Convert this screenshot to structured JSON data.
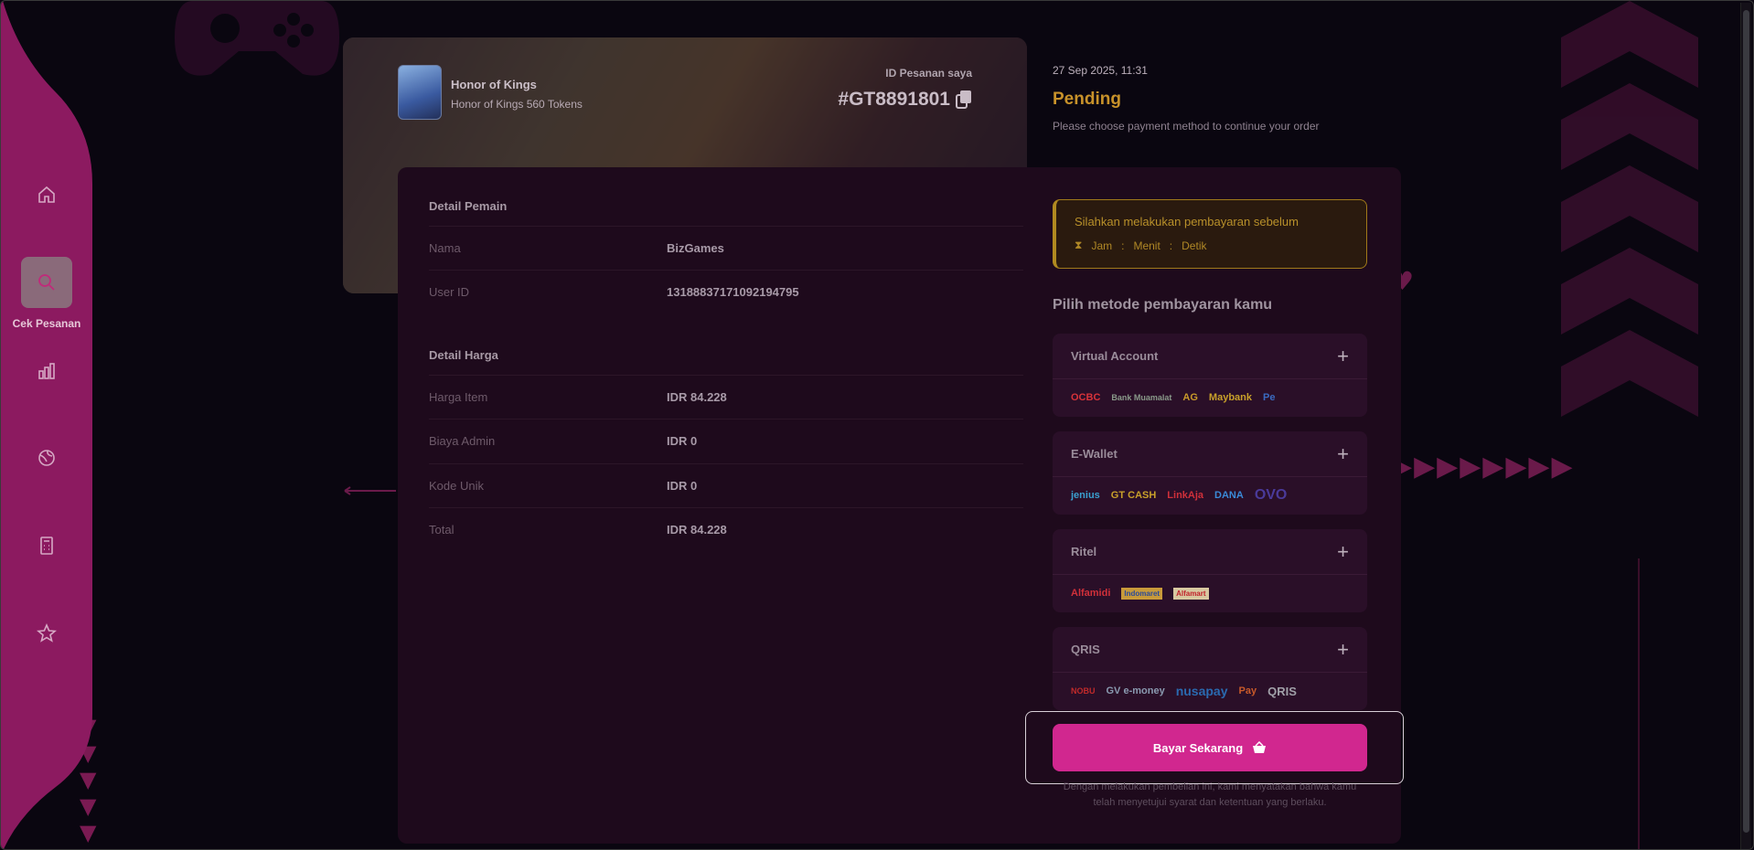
{
  "sidebar": {
    "items": [
      {
        "icon": "home-icon",
        "label": ""
      },
      {
        "icon": "search-icon",
        "label": "Cek Pesanan",
        "active": true
      },
      {
        "icon": "bar-chart-icon",
        "label": ""
      },
      {
        "icon": "globe-icon",
        "label": ""
      },
      {
        "icon": "calculator-icon",
        "label": ""
      },
      {
        "icon": "star-icon",
        "label": ""
      }
    ],
    "active_label": "Cek Pesanan"
  },
  "banner": {
    "game": "Honor of Kings",
    "product": "Honor of Kings 560 Tokens",
    "order_label": "ID Pesanan saya",
    "order_id": "#GT8891801"
  },
  "order_status": {
    "date": "27 Sep 2025, 11:31",
    "status": "Pending",
    "message": "Please choose payment method to continue your order"
  },
  "player": {
    "title": "Detail Pemain",
    "rows": [
      {
        "key": "Nama",
        "value": "BizGames"
      },
      {
        "key": "User ID",
        "value": "13188837171092194795"
      }
    ]
  },
  "price": {
    "title": "Detail Harga",
    "rows": [
      {
        "key": "Harga Item",
        "value": "IDR 84.228"
      },
      {
        "key": "Biaya Admin",
        "value": "IDR 0"
      },
      {
        "key": "Kode Unik",
        "value": "IDR 0"
      },
      {
        "key": "Total",
        "value": "IDR 84.228"
      }
    ]
  },
  "timer": {
    "text": "Silahkan melakukan pembayaran sebelum",
    "jam": "Jam",
    "menit": "Menit",
    "detik": "Detik",
    "sep": ":"
  },
  "payment": {
    "title": "Pilih metode pembayaran kamu",
    "methods": [
      {
        "name": "Virtual Account",
        "logos": [
          "OCBC",
          "Bank Muamalat",
          "AG",
          "Maybank",
          "Pe"
        ]
      },
      {
        "name": "E-Wallet",
        "logos": [
          "jenius",
          "GT CASH",
          "LinkAja",
          "DANA",
          "OVO"
        ]
      },
      {
        "name": "Ritel",
        "logos": [
          "Alfamidi",
          "Indomaret",
          "Alfamart"
        ]
      },
      {
        "name": "QRIS",
        "logos": [
          "NOBU",
          "GV e-money",
          "nusapay",
          "Pay",
          "QRIS"
        ]
      }
    ]
  },
  "pay_button": {
    "label": "Bayar Sekarang"
  },
  "terms": "Dengan melakukan pembelian ini, kami menyatakan bahwa kamu telah menyetujui syarat dan ketentuan yang berlaku.",
  "colors": {
    "accent": "#d1278f",
    "pending": "#c8922a",
    "sidebar": "#9a1a66"
  }
}
